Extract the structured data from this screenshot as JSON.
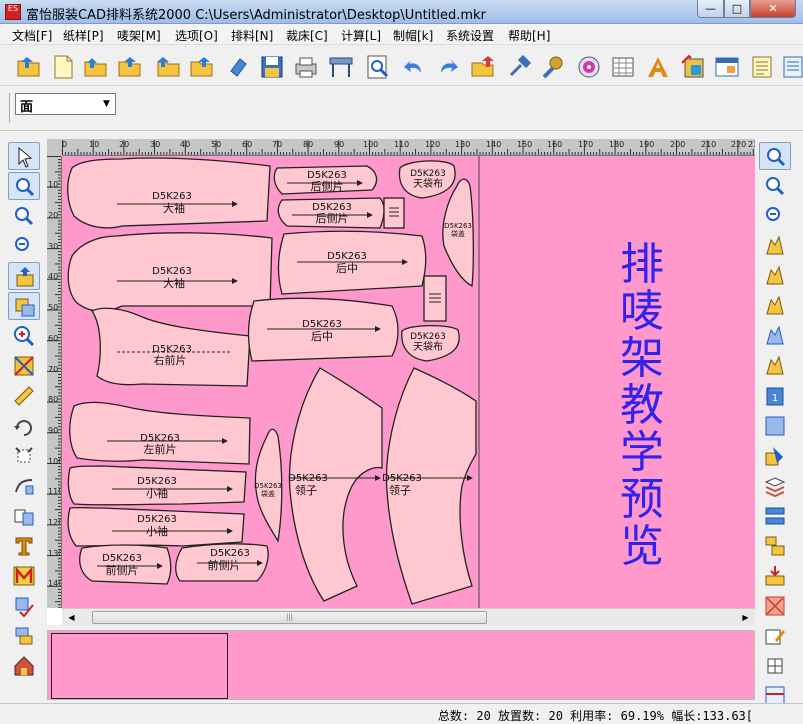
{
  "window": {
    "title": "富怡服装CAD排料系统2000 C:\\Users\\Administrator\\Desktop\\Untitled.mkr",
    "app_icon_text": "ES",
    "minimize": "—",
    "maximize": "□",
    "close": "✕"
  },
  "menubar": {
    "items": [
      {
        "label": "文档[F]"
      },
      {
        "label": "纸样[P]"
      },
      {
        "label": "唛架[M]"
      },
      {
        "label": "选项[O]"
      },
      {
        "label": "排料[N]"
      },
      {
        "label": "裁床[C]"
      },
      {
        "label": "计算[L]"
      },
      {
        "label": "制帽[k]"
      },
      {
        "label": "系统设置"
      },
      {
        "label": "帮助[H]"
      }
    ]
  },
  "toolbar": {
    "layer_select_value": "面",
    "buttons": [
      {
        "icon": "open-folder-icon"
      },
      {
        "icon": "new-document-icon"
      },
      {
        "icon": "open-marker-icon"
      },
      {
        "icon": "open-style-icon"
      },
      {
        "icon": "import-icon"
      },
      {
        "icon": "folder-icon"
      },
      {
        "icon": "eraser-icon"
      },
      {
        "icon": "save-icon"
      },
      {
        "icon": "print-icon"
      },
      {
        "icon": "plotter-icon"
      },
      {
        "icon": "zoom-preview-icon"
      },
      {
        "icon": "undo-icon"
      },
      {
        "icon": "redo-icon"
      },
      {
        "icon": "import-piece-icon"
      },
      {
        "icon": "tools-icon"
      },
      {
        "icon": "settings-icon"
      },
      {
        "icon": "cd-icon"
      },
      {
        "icon": "table-icon"
      },
      {
        "icon": "text-icon"
      },
      {
        "icon": "color-icon"
      },
      {
        "icon": "window-icon"
      },
      {
        "icon": "list-icon"
      },
      {
        "icon": "notes-icon"
      }
    ]
  },
  "colors": {
    "sheet": "#ff99cc",
    "piece_fill": "#ffc8d0",
    "piece_outline": "#222222",
    "title_text": "#3322ee"
  },
  "ruler": {
    "h_labels": [
      "0",
      "10",
      "20",
      "30",
      "40",
      "50",
      "60",
      "70",
      "80",
      "90",
      "100",
      "110",
      "120",
      "130",
      "140",
      "150",
      "160",
      "170",
      "180",
      "190",
      "200",
      "210",
      "220",
      "230"
    ],
    "v_labels": [
      "10",
      "20",
      "30",
      "40",
      "50",
      "60",
      "70",
      "80",
      "90",
      "100",
      "110",
      "120",
      "130",
      "140"
    ]
  },
  "pieces": [
    {
      "id": "D5K263",
      "name": "大袖"
    },
    {
      "id": "D5K263",
      "name": "大袖"
    },
    {
      "id": "D5K263",
      "name": "右前片"
    },
    {
      "id": "D5K263",
      "name": "左前片"
    },
    {
      "id": "D5K263",
      "name": "小袖"
    },
    {
      "id": "D5K263",
      "name": "小袖"
    },
    {
      "id": "D5K263",
      "name": "前侧片"
    },
    {
      "id": "D5K263",
      "name": "前侧片"
    },
    {
      "id": "D5K263",
      "name": "后侧片"
    },
    {
      "id": "D5K263",
      "name": "后侧片"
    },
    {
      "id": "D5K263",
      "name": "后中"
    },
    {
      "id": "D5K263",
      "name": "后中"
    },
    {
      "id": "D5K263",
      "name": "天袋布"
    },
    {
      "id": "D5K263",
      "name": "天袋布"
    },
    {
      "id": "D5K263",
      "name": "领子"
    },
    {
      "id": "D5K263",
      "name": "领子"
    },
    {
      "id": "D5K263",
      "name": "袋盖"
    },
    {
      "id": "D5K263",
      "name": "袋盖"
    }
  ],
  "preview_title": "排唛架教学预览",
  "scroll_marker": "|||",
  "statusbar": {
    "text": "总数: 20 放置数: 20 利用率: 69.19% 幅长:133.63["
  }
}
